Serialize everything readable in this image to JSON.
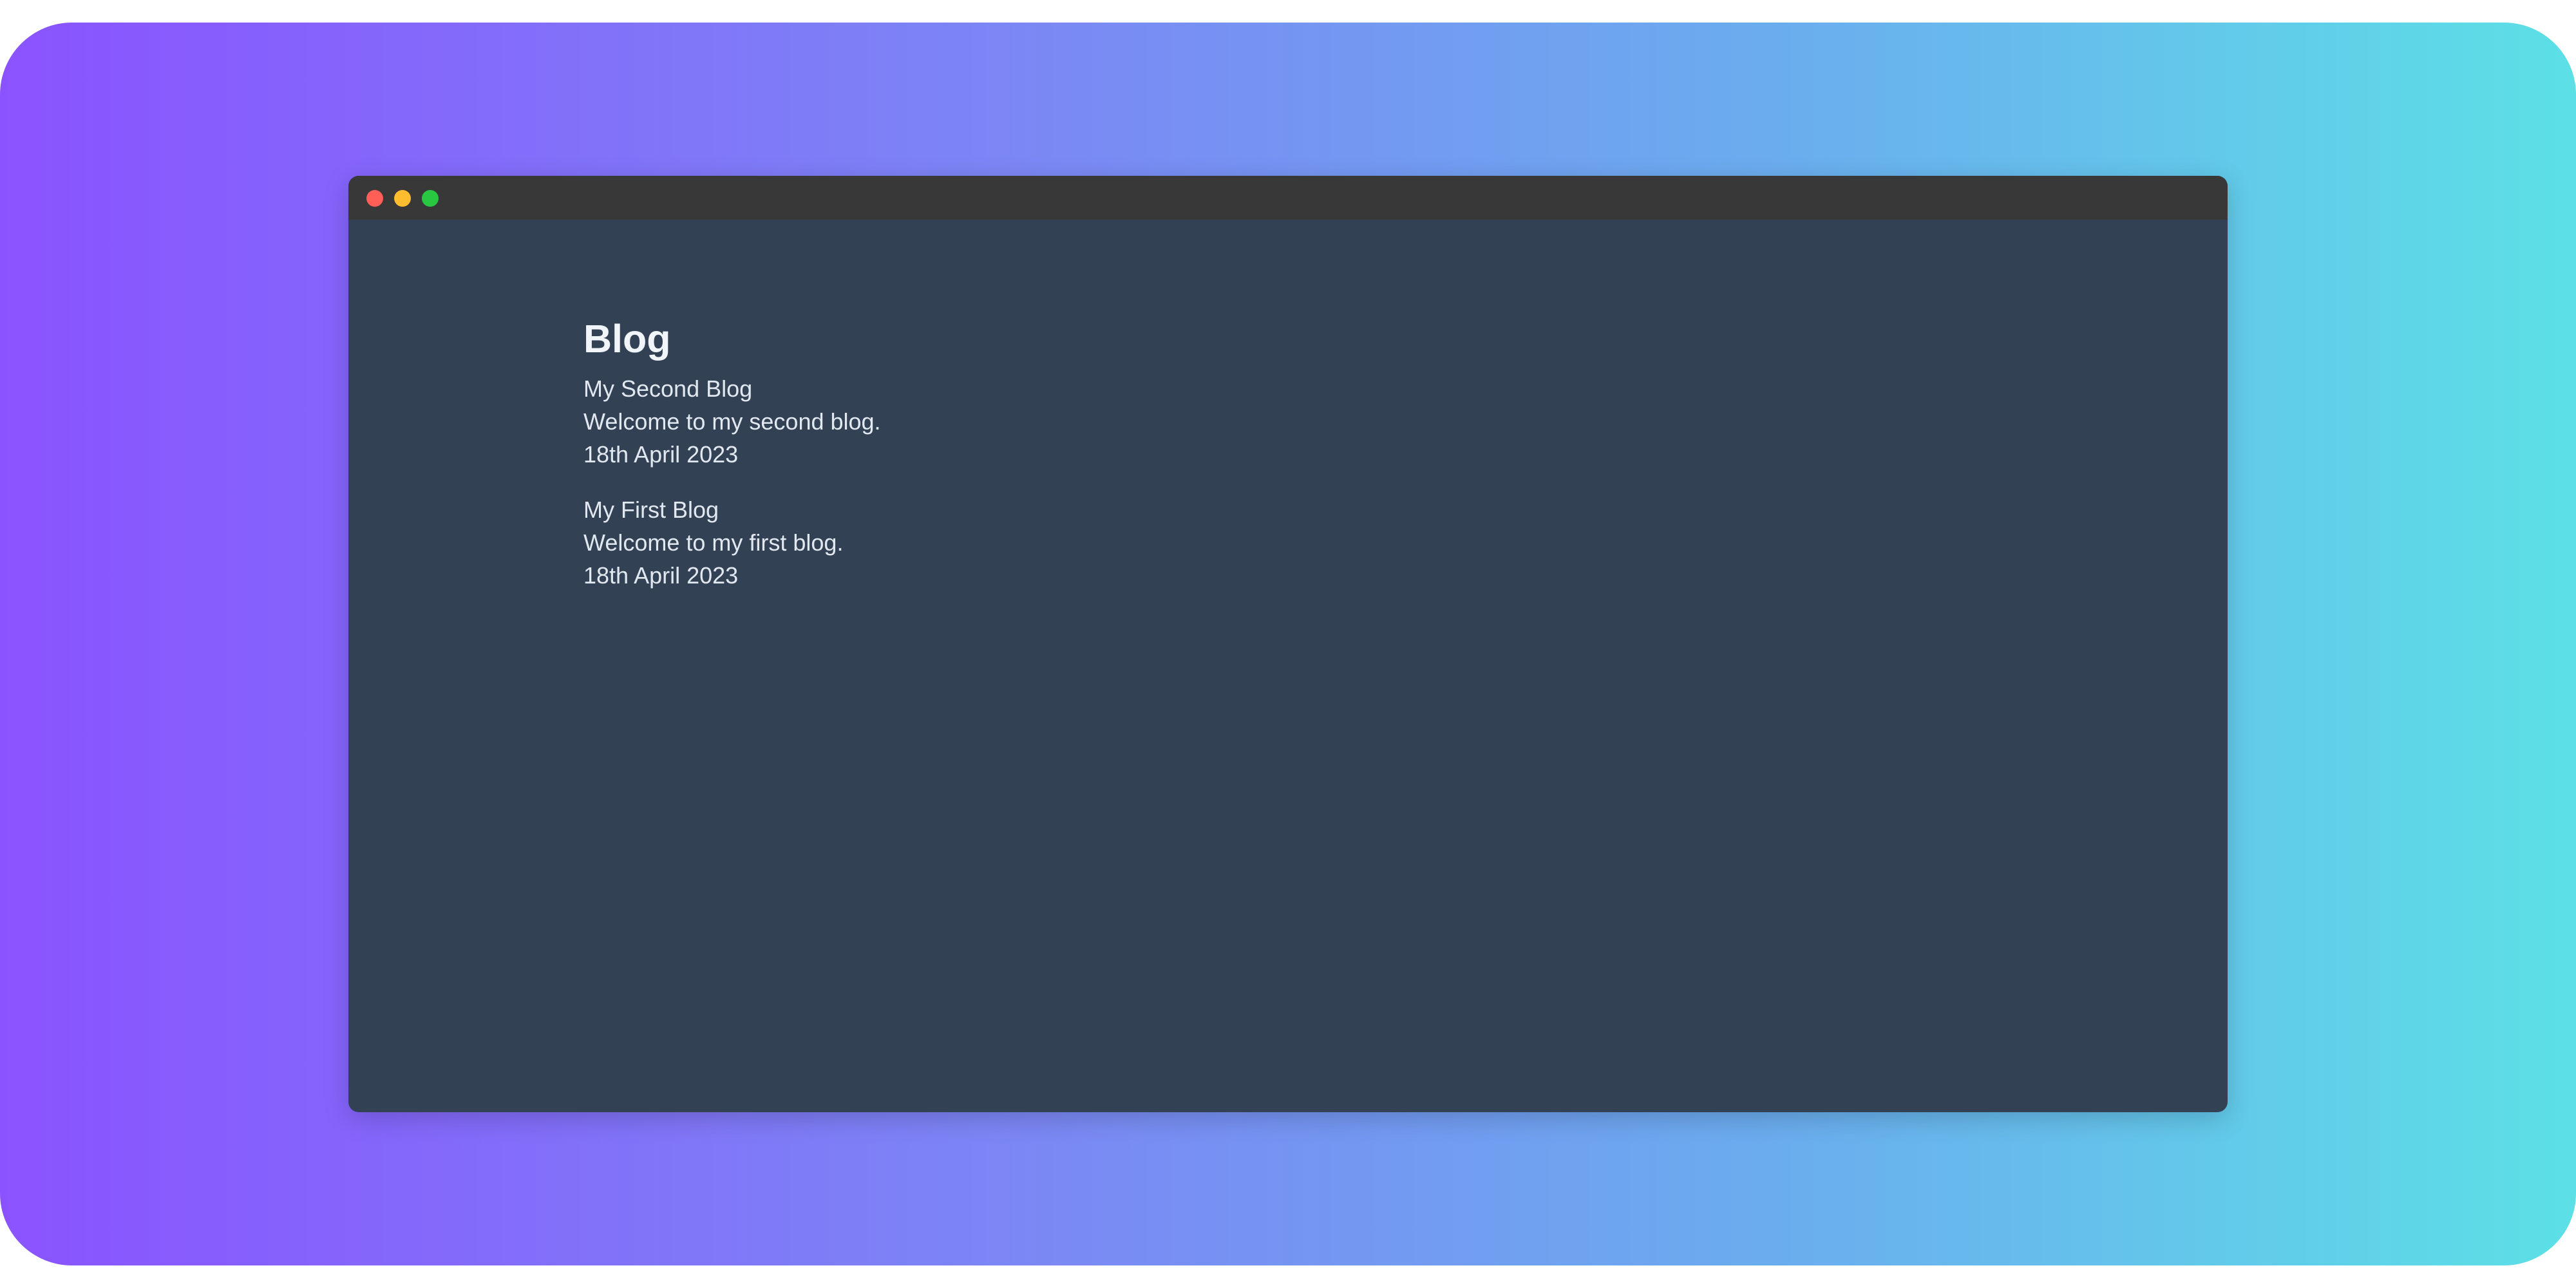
{
  "colors": {
    "gradient_start": "#8a53ff",
    "gradient_end": "#5ce0e6",
    "window_bg": "#334155",
    "titlebar_bg": "#383838",
    "close": "#ff5f57",
    "minimize": "#febc2e",
    "maximize": "#28c840"
  },
  "page": {
    "title": "Blog"
  },
  "posts": [
    {
      "title": "My Second Blog",
      "summary": "Welcome to my second blog.",
      "date": "18th April 2023"
    },
    {
      "title": "My First Blog",
      "summary": "Welcome to my first blog.",
      "date": "18th April 2023"
    }
  ]
}
